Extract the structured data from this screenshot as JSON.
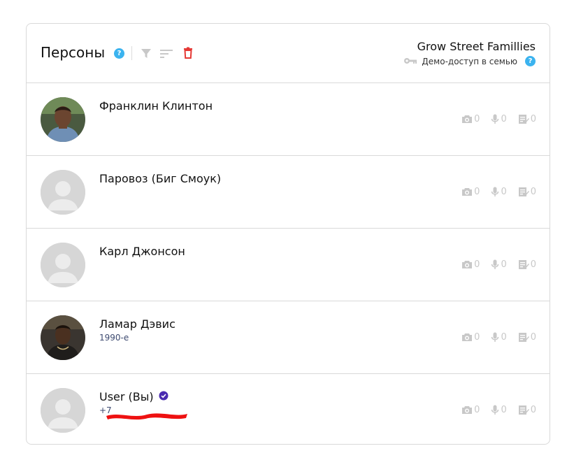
{
  "header": {
    "title": "Персоны",
    "help_icon": "question-icon",
    "tools": [
      "filter-icon",
      "sort-icon",
      "trash-icon"
    ],
    "family_name": "Grow Street Famillies",
    "access_text": "Демо-доступ в семью",
    "colors": {
      "help": "#3bb3ef",
      "trash": "#e53935",
      "muted": "#c8c8c8"
    }
  },
  "persons": [
    {
      "name": "Франклин Клинтон",
      "subtitle": "",
      "avatar": "photo",
      "photos": "0",
      "audio": "0",
      "notes": "0"
    },
    {
      "name": "Паровоз (Биг Смоук)",
      "subtitle": "",
      "avatar": "placeholder",
      "photos": "0",
      "audio": "0",
      "notes": "0"
    },
    {
      "name": "Карл Джонсон",
      "subtitle": "",
      "avatar": "placeholder",
      "photos": "0",
      "audio": "0",
      "notes": "0"
    },
    {
      "name": "Ламар Дэвис",
      "subtitle": "1990-е",
      "avatar": "photo",
      "photos": "0",
      "audio": "0",
      "notes": "0"
    },
    {
      "name": "User (Вы)",
      "subtitle": "+7",
      "avatar": "placeholder",
      "verified": true,
      "redacted": true,
      "photos": "0",
      "audio": "0",
      "notes": "0"
    }
  ]
}
